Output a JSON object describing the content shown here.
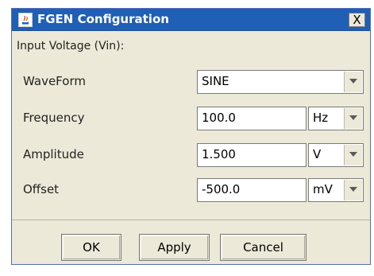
{
  "window": {
    "title": "FGEN Configuration",
    "close_label": "X"
  },
  "section_title": "Input Voltage (Vin):",
  "rows": [
    {
      "label": "WaveForm",
      "value": "SINE"
    },
    {
      "label": "Frequency",
      "value": "100.0",
      "unit": "Hz"
    },
    {
      "label": "Amplitude",
      "value": "1.500",
      "unit": "V"
    },
    {
      "label": "Offset",
      "value": "-500.0",
      "unit": "mV"
    }
  ],
  "buttons": {
    "ok": "OK",
    "apply": "Apply",
    "cancel": "Cancel"
  },
  "colors": {
    "titlebar": "#1f5fb6",
    "dialog_bg": "#ece9d8"
  },
  "icons": [
    "java-app-icon",
    "dropdown-arrow-icon"
  ]
}
